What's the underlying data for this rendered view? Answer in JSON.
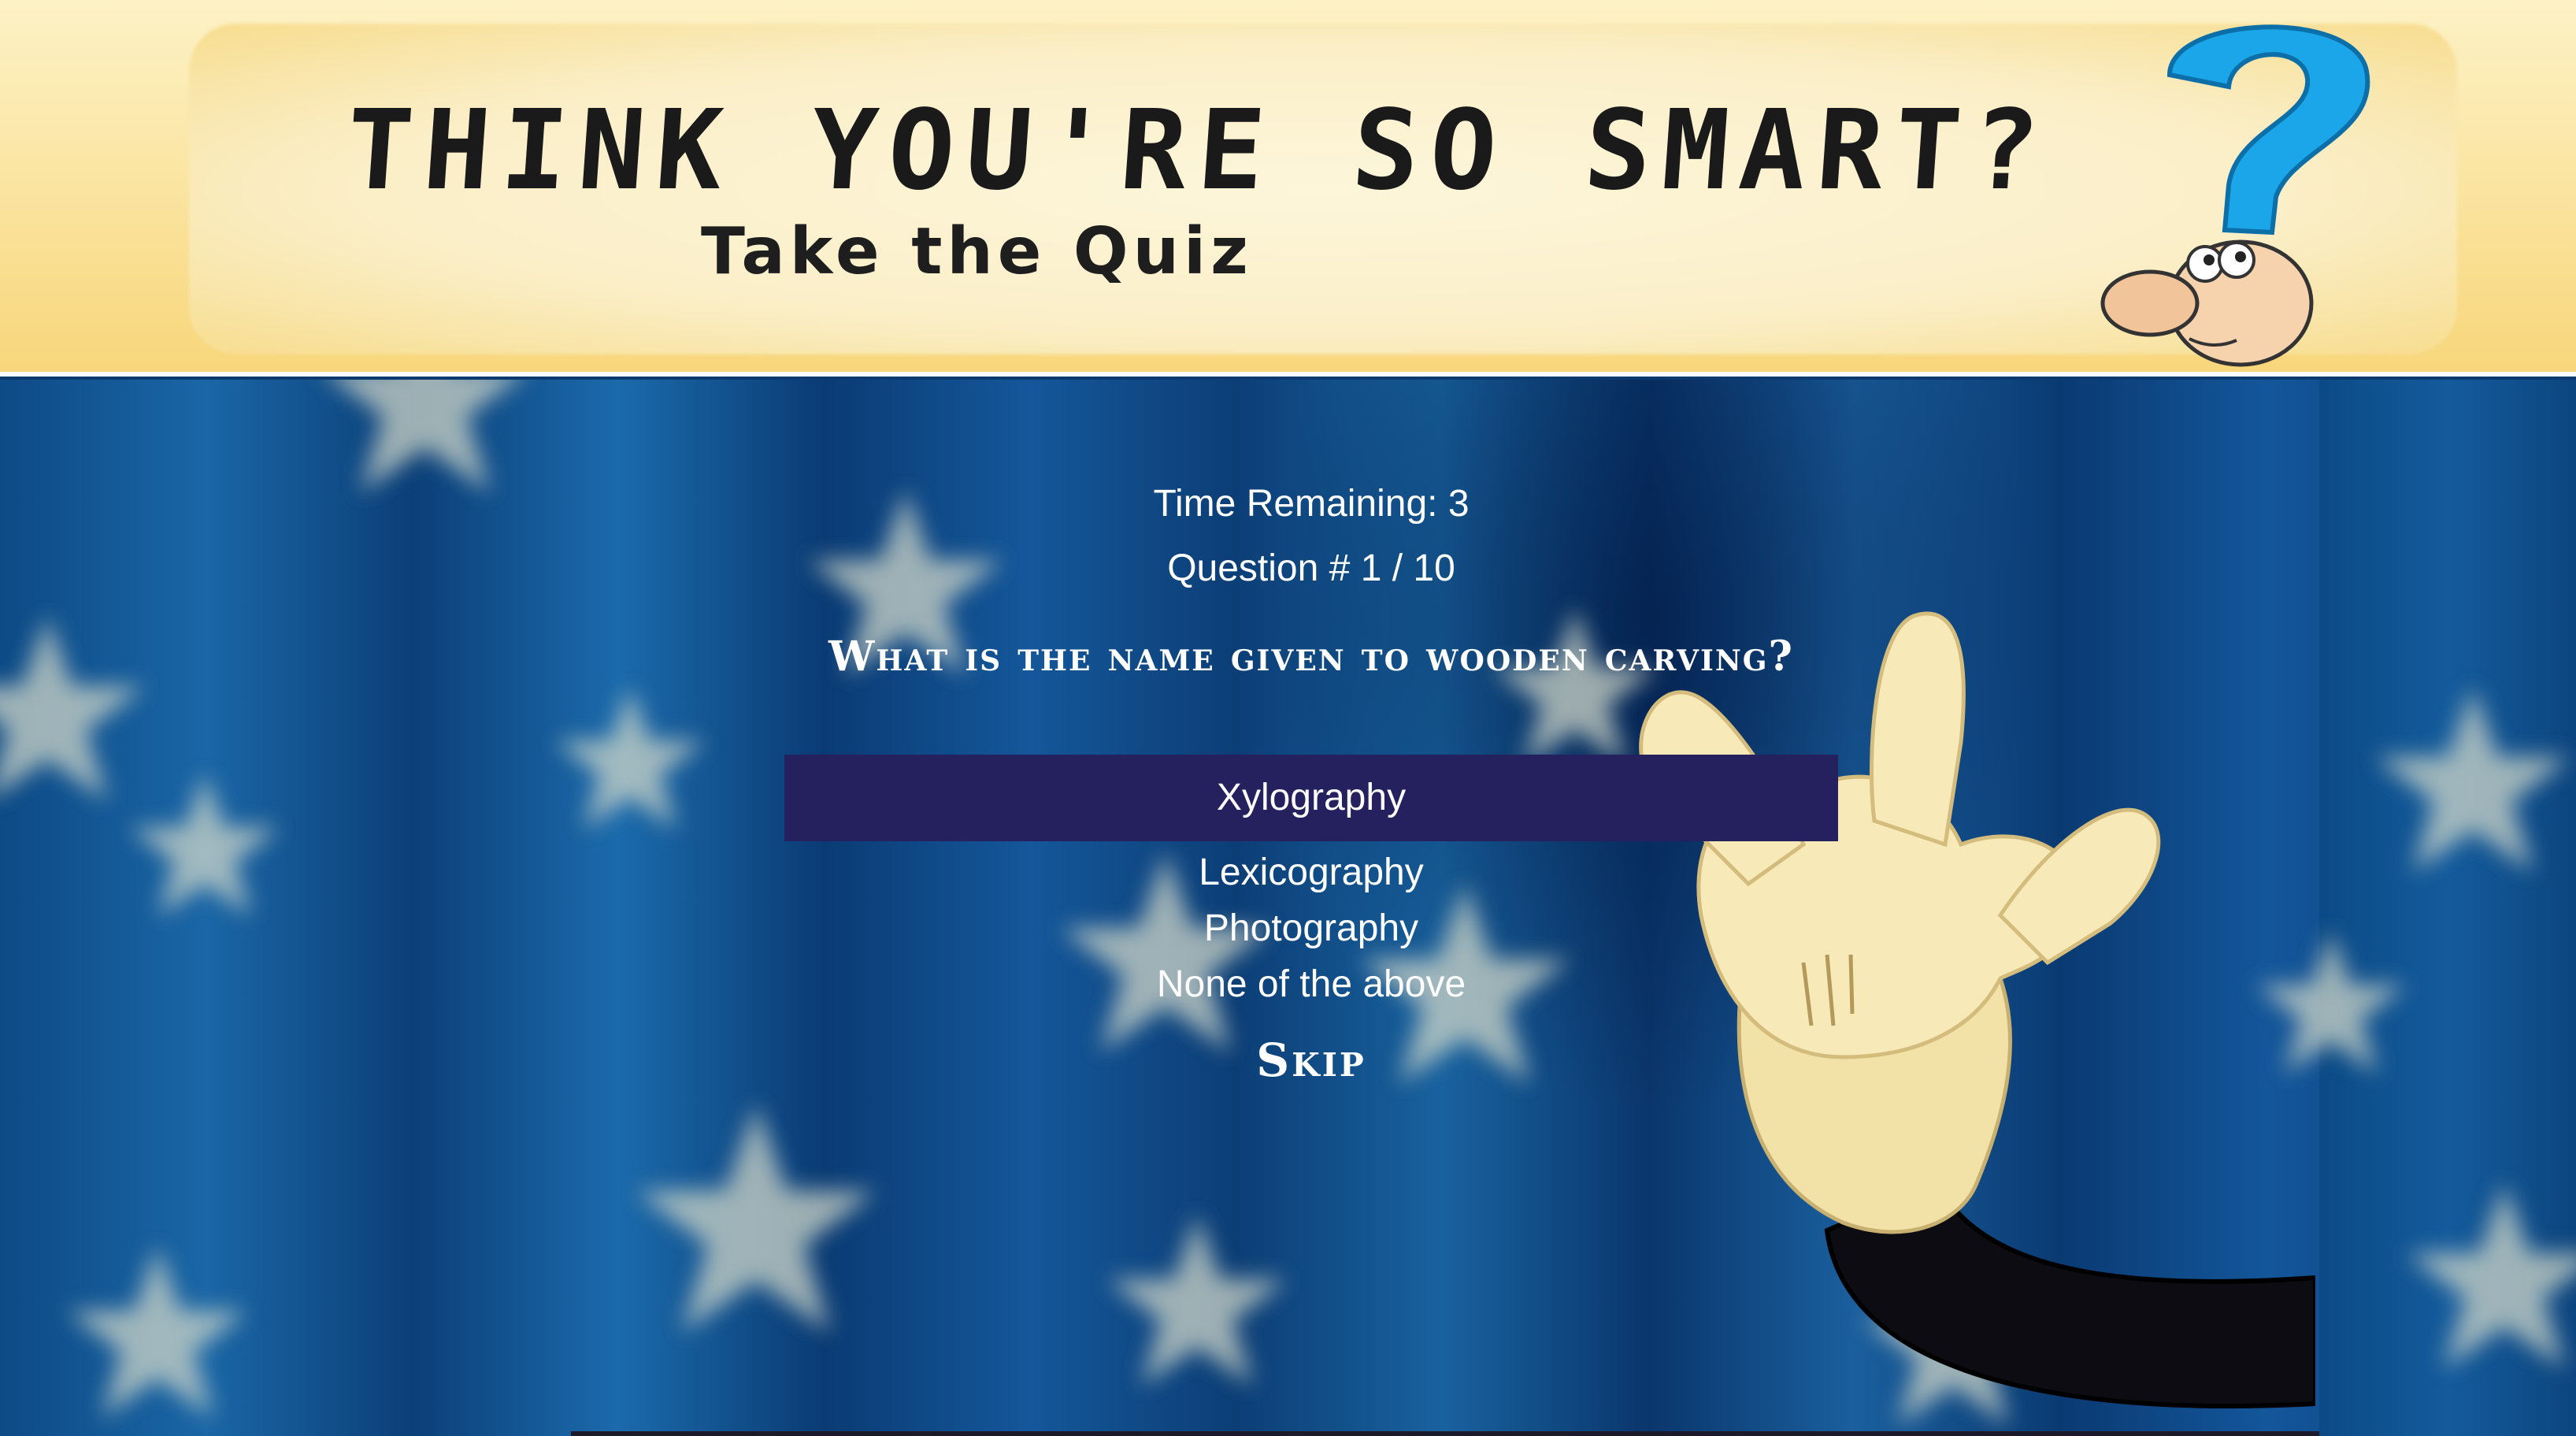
{
  "banner": {
    "title": "THINK YOU'RE SO SMART?",
    "subtitle": "Take the Quiz",
    "mascot_icon": "question-mark-head-icon"
  },
  "quiz": {
    "timer_label": "Time Remaining: 3",
    "question_counter": "Question # 1 / 10",
    "question": "What is the name given to wooden carving?",
    "answers": [
      {
        "label": "Xylography",
        "selected": true
      },
      {
        "label": "Lexicography",
        "selected": false
      },
      {
        "label": "Photography",
        "selected": false
      },
      {
        "label": "None of the above",
        "selected": false
      }
    ],
    "skip_label": "Skip"
  },
  "colors": {
    "banner_bg": "#f8d67a",
    "stage_bg": "#0b3a70",
    "selected_answer_bg": "#25205e",
    "text": "#ffffff"
  },
  "decorations": {
    "background_icon": "star-pattern-icon",
    "hand_icon": "cartoon-hand-icon"
  }
}
